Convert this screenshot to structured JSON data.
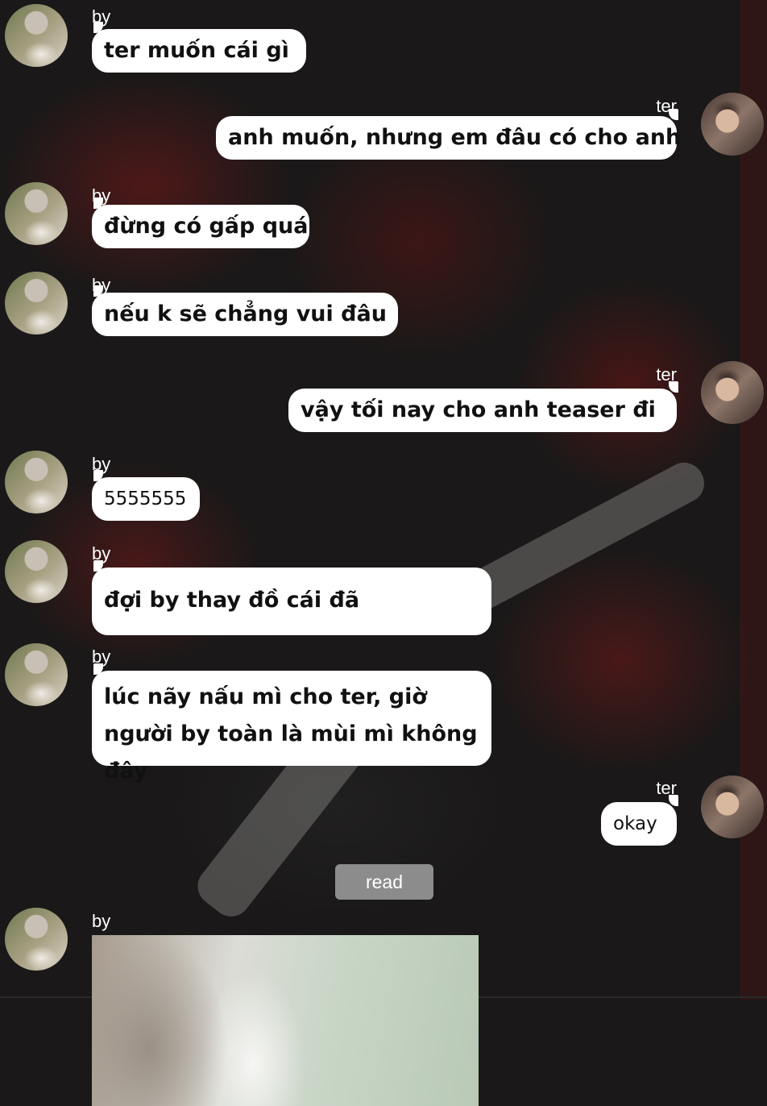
{
  "messages": [
    {
      "sender": "by",
      "name": "by",
      "text": "ter muốn cái gì"
    },
    {
      "sender": "ter",
      "name": "ter",
      "text": "anh muốn, nhưng em đâu có cho anh"
    },
    {
      "sender": "by",
      "name": "by",
      "text": "đừng có gấp quá"
    },
    {
      "sender": "by",
      "name": "by",
      "text": "nếu k sẽ chẳng vui đâu"
    },
    {
      "sender": "ter",
      "name": "ter",
      "text": "vậy tối nay cho anh teaser đi"
    },
    {
      "sender": "by",
      "name": "by",
      "text": "5555555"
    },
    {
      "sender": "by",
      "name": "by",
      "text": "đợi by thay đồ cái đã"
    },
    {
      "sender": "by",
      "name": "by",
      "text": "lúc nãy nấu mì cho ter, giờ người by toàn là mùi mì không đây"
    },
    {
      "sender": "ter",
      "name": "ter",
      "text": "okay"
    },
    {
      "sender": "by",
      "name": "by",
      "text": ""
    }
  ],
  "read_label": "read",
  "colors": {
    "bubble": "#ffffff",
    "read_pill": "#8c8c8c",
    "name_text": "#ffffff"
  }
}
